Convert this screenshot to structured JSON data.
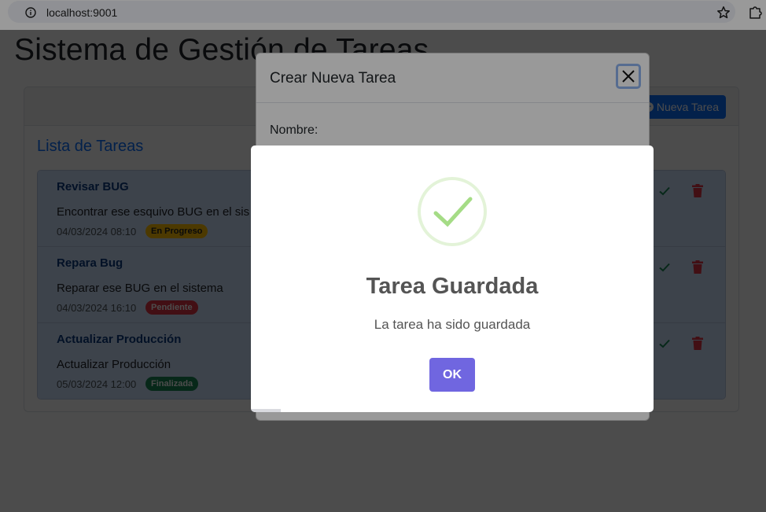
{
  "browser": {
    "url": "localhost:9001",
    "icons": [
      "info-icon",
      "star-icon",
      "extensions-icon"
    ]
  },
  "page": {
    "title": "Sistema de Gestión de Tareas",
    "new_task_label": "Nueva Tarea",
    "list_title": "Lista de Tareas",
    "tasks": [
      {
        "name": "Revisar BUG",
        "description": "Encontrar ese esquivo BUG en el sis",
        "date": "04/03/2024 08:10",
        "status": "En Progreso"
      },
      {
        "name": "Repara Bug",
        "description": "Reparar ese BUG en el sistema",
        "date": "04/03/2024 16:10",
        "status": "Pendiente"
      },
      {
        "name": "Actualizar Producción",
        "description": "Actualizar Producción",
        "date": "05/03/2024 12:00",
        "status": "Finalizada"
      }
    ]
  },
  "modal": {
    "title": "Crear Nueva Tarea",
    "name_label": "Nombre:"
  },
  "alert": {
    "title": "Tarea Guardada",
    "text": "La tarea ha sido guardada",
    "ok_label": "OK",
    "icon": "success-check-icon"
  },
  "colors": {
    "primary": "#0d6efd",
    "confirm": "#7066e0",
    "success": "#a5dc86",
    "badge_progress": "#ffc107",
    "badge_pending": "#dc3545",
    "badge_done": "#198754"
  }
}
